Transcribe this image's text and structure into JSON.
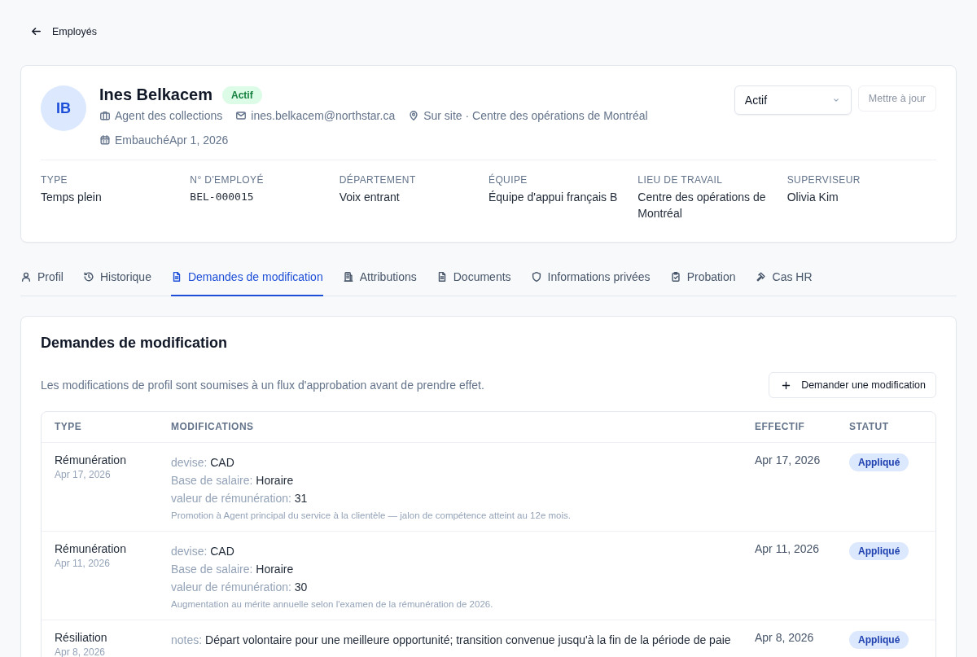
{
  "back_link": {
    "label": "Employés"
  },
  "employee": {
    "initials": "IB",
    "name": "Ines Belkacem",
    "status_badge": "Actif",
    "meta": [
      {
        "kind": "briefcase",
        "text": "Agent des collections"
      },
      {
        "kind": "mail",
        "text": "ines.belkacem@northstar.ca"
      },
      {
        "kind": "pin",
        "text": "Sur site · Centre des opérations de Montréal"
      },
      {
        "kind": "calendar",
        "text": "EmbauchéApr 1, 2026"
      }
    ],
    "status_select": {
      "value": "Actif"
    },
    "update_button": {
      "label": "Mettre à jour",
      "disabled": true
    },
    "fields": [
      {
        "label": "TYPE",
        "value": "Temps plein",
        "kind": "text"
      },
      {
        "label": "N° D'EMPLOYÉ",
        "value": "BEL-000015",
        "kind": "mono"
      },
      {
        "label": "DÉPARTEMENT",
        "value": "Voix entrant",
        "kind": "text"
      },
      {
        "label": "ÉQUIPE",
        "value": "Équipe d'appui français B",
        "kind": "text"
      },
      {
        "label": "LIEU DE TRAVAIL",
        "value": "Centre des opérations de Montréal",
        "kind": "text"
      },
      {
        "label": "SUPERVISEUR",
        "value": "Olivia Kim",
        "kind": "text"
      }
    ]
  },
  "tabs": [
    {
      "label": "Profil",
      "selected": false
    },
    {
      "label": "Historique",
      "selected": false
    },
    {
      "label": "Demandes de modification",
      "selected": true
    },
    {
      "label": "Attributions",
      "selected": false
    },
    {
      "label": "Documents",
      "selected": false
    },
    {
      "label": "Informations privées",
      "selected": false
    },
    {
      "label": "Probation",
      "selected": false
    },
    {
      "label": "Cas HR",
      "selected": false
    }
  ],
  "section": {
    "title": "Demandes de modification",
    "description": "Les modifications de profil sont soumises à un flux d'approbation avant de prendre effet.",
    "request_button": {
      "label": "Demander une modification"
    },
    "table": {
      "columns": [
        "TYPE",
        "MODIFICATIONS",
        "EFFECTIF",
        "STATUT"
      ],
      "rows": [
        {
          "type": "Rémunération",
          "date": "Apr 17, 2026",
          "changes": [
            {
              "field": "devise:",
              "value": "CAD"
            },
            {
              "field": "Base de salaire:",
              "value": "Horaire"
            },
            {
              "field": "valeur de rémunération:",
              "value": "31"
            }
          ],
          "note": "Promotion à Agent principal du service à la clientèle — jalon de compétence atteint au 12e mois.",
          "effective": "Apr 17, 2026",
          "status": "Appliqué"
        },
        {
          "type": "Rémunération",
          "date": "Apr 11, 2026",
          "changes": [
            {
              "field": "devise:",
              "value": "CAD"
            },
            {
              "field": "Base de salaire:",
              "value": "Horaire"
            },
            {
              "field": "valeur de rémunération:",
              "value": "30"
            }
          ],
          "note": "Augmentation au mérite annuelle selon l'examen de la rémunération de 2026.",
          "effective": "Apr 11, 2026",
          "status": "Appliqué"
        },
        {
          "type": "Résiliation",
          "date": "Apr 8, 2026",
          "changes": [
            {
              "field": "notes:",
              "value": "Départ volontaire pour une meilleure opportunité; transition convenue jusqu'à la fin de la période de paie"
            }
          ],
          "effective": "Apr 8, 2026",
          "status": "Appliqué"
        }
      ]
    }
  }
}
